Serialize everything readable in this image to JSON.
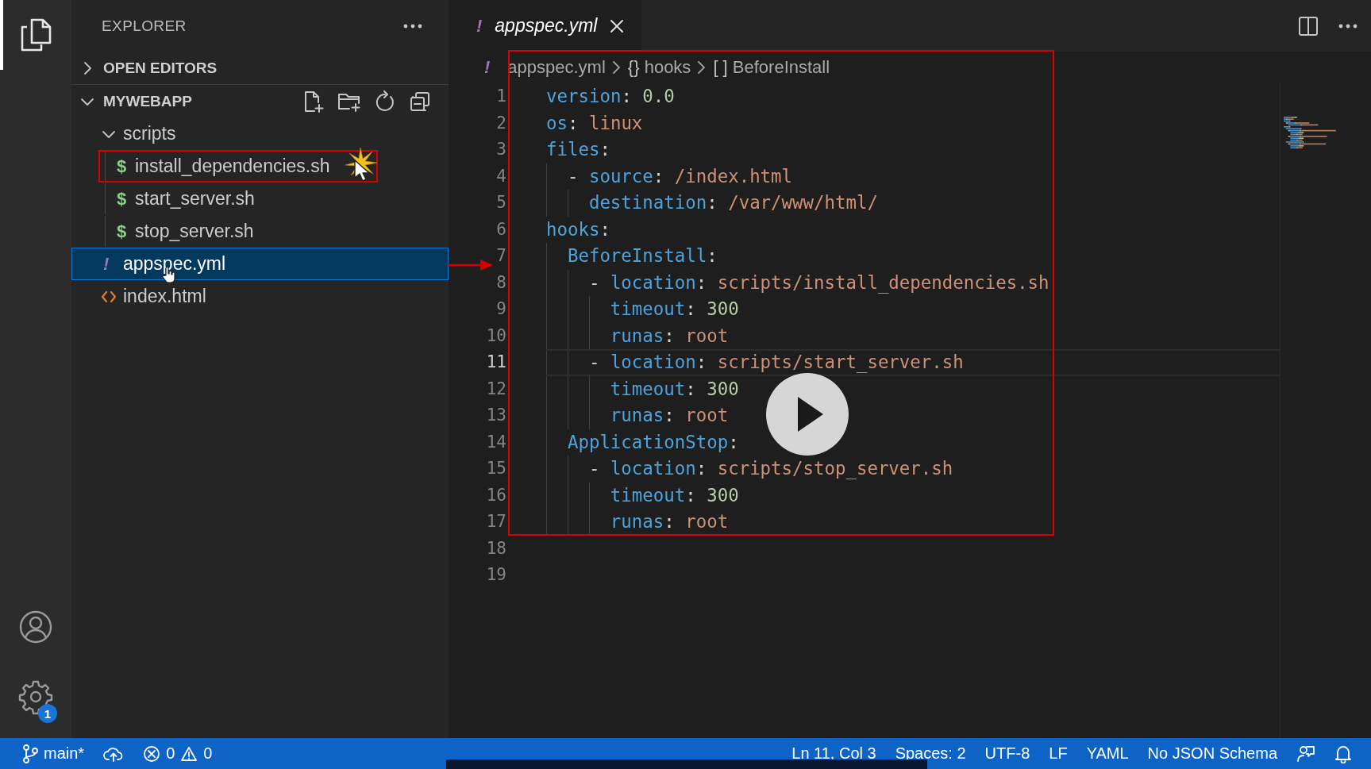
{
  "activity_bar": {
    "top": [
      {
        "kind": "explorer",
        "selected": true
      }
    ],
    "bottom": [
      {
        "kind": "account"
      },
      {
        "kind": "settings",
        "badge": "1"
      }
    ]
  },
  "sidebar": {
    "title": "EXPLORER",
    "sections": [
      {
        "label": "OPEN EDITORS",
        "expanded": false
      },
      {
        "label": "MYWEBAPP",
        "expanded": true,
        "actions": [
          {
            "kind": "new-file"
          },
          {
            "kind": "new-folder"
          },
          {
            "kind": "refresh"
          },
          {
            "kind": "collapse"
          }
        ],
        "tree": [
          {
            "label": "scripts",
            "kind": "folder",
            "expanded": true,
            "selected": false,
            "highlighted": false,
            "children": [
              {
                "label": "install_dependencies.sh",
                "kind": "shell",
                "glyph": "$",
                "selected": false,
                "highlighted": true,
                "cursor": {
                  "kind": "pointer"
                }
              },
              {
                "label": "start_server.sh",
                "kind": "shell",
                "glyph": "$",
                "selected": false,
                "highlighted": false
              },
              {
                "label": "stop_server.sh",
                "kind": "shell",
                "glyph": "$",
                "selected": false,
                "highlighted": false
              }
            ]
          },
          {
            "label": "appspec.yml",
            "kind": "yaml",
            "glyph": "!",
            "selected": true,
            "highlighted": false,
            "cursor": {
              "kind": "hand"
            }
          },
          {
            "label": "index.html",
            "kind": "html",
            "selected": false,
            "highlighted": false
          }
        ]
      }
    ]
  },
  "editor": {
    "tabs": [
      {
        "glyph": "!",
        "label": "appspec.yml",
        "selected": true,
        "preview": true
      }
    ],
    "actions": [
      {
        "kind": "split"
      },
      {
        "kind": "more"
      }
    ],
    "breadcrumb": [
      {
        "kind": "file",
        "glyph": "!",
        "label": "appspec.yml"
      },
      {
        "kind": "object",
        "symbol": "{}",
        "label": "hooks"
      },
      {
        "kind": "array",
        "symbol": "[ ]",
        "label": "BeforeInstall"
      }
    ],
    "lines": [
      {
        "number": "1",
        "current": false,
        "tokens": [
          {
            "kind": "key",
            "text": "version"
          },
          {
            "kind": "punct",
            "text": ": "
          },
          {
            "kind": "number",
            "text": "0.0"
          }
        ]
      },
      {
        "number": "2",
        "current": false,
        "tokens": [
          {
            "kind": "key",
            "text": "os"
          },
          {
            "kind": "punct",
            "text": ": "
          },
          {
            "kind": "string",
            "text": "linux"
          }
        ]
      },
      {
        "number": "3",
        "current": false,
        "tokens": [
          {
            "kind": "key",
            "text": "files"
          },
          {
            "kind": "punct",
            "text": ":"
          }
        ],
        "children": [
          {
            "number": "4",
            "current": false,
            "tokens": [
              {
                "kind": "punct",
                "text": "- "
              },
              {
                "kind": "key",
                "text": "source"
              },
              {
                "kind": "punct",
                "text": ": "
              },
              {
                "kind": "string",
                "text": "/index.html"
              }
            ],
            "children": [
              {
                "number": "5",
                "current": false,
                "tokens": [
                  {
                    "kind": "key",
                    "text": "destination"
                  },
                  {
                    "kind": "punct",
                    "text": ": "
                  },
                  {
                    "kind": "string",
                    "text": "/var/www/html/"
                  }
                ]
              }
            ]
          }
        ]
      },
      {
        "number": "6",
        "current": false,
        "tokens": [
          {
            "kind": "key",
            "text": "hooks"
          },
          {
            "kind": "punct",
            "text": ":"
          }
        ],
        "children": [
          {
            "number": "7",
            "current": false,
            "tokens": [
              {
                "kind": "key",
                "text": "BeforeInstall"
              },
              {
                "kind": "punct",
                "text": ":"
              }
            ],
            "children": [
              {
                "number": "8",
                "current": false,
                "tokens": [
                  {
                    "kind": "punct",
                    "text": "- "
                  },
                  {
                    "kind": "key",
                    "text": "location"
                  },
                  {
                    "kind": "punct",
                    "text": ": "
                  },
                  {
                    "kind": "string",
                    "text": "scripts/install_dependencies.sh"
                  }
                ],
                "children": [
                  {
                    "number": "9",
                    "current": false,
                    "tokens": [
                      {
                        "kind": "key",
                        "text": "timeout"
                      },
                      {
                        "kind": "punct",
                        "text": ": "
                      },
                      {
                        "kind": "number",
                        "text": "300"
                      }
                    ]
                  },
                  {
                    "number": "10",
                    "current": false,
                    "tokens": [
                      {
                        "kind": "key",
                        "text": "runas"
                      },
                      {
                        "kind": "punct",
                        "text": ": "
                      },
                      {
                        "kind": "string",
                        "text": "root"
                      }
                    ]
                  }
                ]
              },
              {
                "number": "11",
                "current": true,
                "tokens": [
                  {
                    "kind": "punct",
                    "text": "- "
                  },
                  {
                    "kind": "key",
                    "text": "location"
                  },
                  {
                    "kind": "punct",
                    "text": ": "
                  },
                  {
                    "kind": "string",
                    "text": "scripts/start_server.sh"
                  }
                ],
                "children": [
                  {
                    "number": "12",
                    "current": false,
                    "tokens": [
                      {
                        "kind": "key",
                        "text": "timeout"
                      },
                      {
                        "kind": "punct",
                        "text": ": "
                      },
                      {
                        "kind": "number",
                        "text": "300"
                      }
                    ]
                  },
                  {
                    "number": "13",
                    "current": false,
                    "tokens": [
                      {
                        "kind": "key",
                        "text": "runas"
                      },
                      {
                        "kind": "punct",
                        "text": ": "
                      },
                      {
                        "kind": "string",
                        "text": "root"
                      }
                    ]
                  }
                ]
              }
            ]
          },
          {
            "number": "14",
            "current": false,
            "tokens": [
              {
                "kind": "key",
                "text": "ApplicationStop"
              },
              {
                "kind": "punct",
                "text": ":"
              }
            ],
            "children": [
              {
                "number": "15",
                "current": false,
                "tokens": [
                  {
                    "kind": "punct",
                    "text": "- "
                  },
                  {
                    "kind": "key",
                    "text": "location"
                  },
                  {
                    "kind": "punct",
                    "text": ": "
                  },
                  {
                    "kind": "string",
                    "text": "scripts/stop_server.sh"
                  }
                ],
                "children": [
                  {
                    "number": "16",
                    "current": false,
                    "tokens": [
                      {
                        "kind": "key",
                        "text": "timeout"
                      },
                      {
                        "kind": "punct",
                        "text": ": "
                      },
                      {
                        "kind": "number",
                        "text": "300"
                      }
                    ]
                  },
                  {
                    "number": "17",
                    "current": false,
                    "tokens": [
                      {
                        "kind": "key",
                        "text": "runas"
                      },
                      {
                        "kind": "punct",
                        "text": ": "
                      },
                      {
                        "kind": "string",
                        "text": "root"
                      }
                    ]
                  }
                ]
              }
            ]
          }
        ]
      },
      {
        "number": "18",
        "current": false
      },
      {
        "number": "19",
        "current": false
      }
    ],
    "annotation": {
      "code_box": true,
      "arrow": true
    }
  },
  "player": {
    "play_button": true,
    "scrub_bar": true
  },
  "status_bar": {
    "left": [
      {
        "kind": "branch",
        "label": "main*"
      },
      {
        "kind": "sync"
      },
      {
        "kind": "problems",
        "errors": "0",
        "warnings": "0"
      }
    ],
    "right": [
      {
        "kind": "text",
        "label": "Ln 11, Col 3"
      },
      {
        "kind": "text",
        "label": "Spaces: 2"
      },
      {
        "kind": "text",
        "label": "UTF-8"
      },
      {
        "kind": "text",
        "label": "LF"
      },
      {
        "kind": "text",
        "label": "YAML"
      },
      {
        "kind": "text",
        "label": "No JSON Schema"
      },
      {
        "kind": "feedback"
      },
      {
        "kind": "notifications"
      }
    ]
  }
}
